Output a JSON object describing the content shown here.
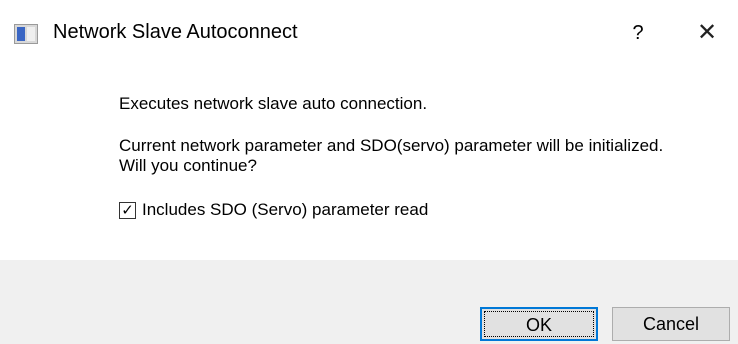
{
  "window": {
    "title": "Network Slave Autoconnect",
    "help_label": "?",
    "close_label": "✕"
  },
  "message": {
    "line1": "Executes network slave auto connection.",
    "line2": "Current network parameter and SDO(servo) parameter will be initialized.",
    "line3": "Will you continue?"
  },
  "checkbox": {
    "label": "Includes SDO (Servo) parameter read",
    "checked": true,
    "mark": "✓"
  },
  "buttons": {
    "ok_label": "OK",
    "cancel_label": "Cancel"
  }
}
